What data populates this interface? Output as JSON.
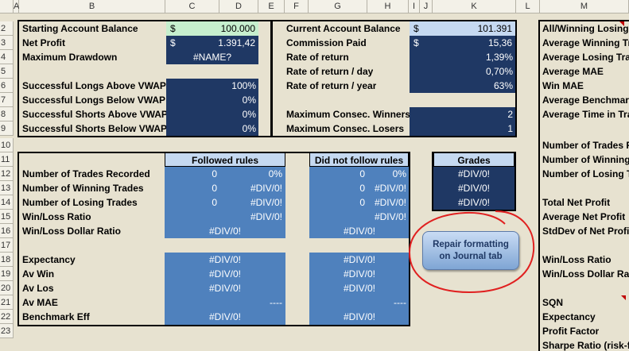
{
  "columns": [
    "A",
    "B",
    "C",
    "D",
    "E",
    "F",
    "G",
    "H",
    "I",
    "J",
    "K",
    "L",
    "M"
  ],
  "rows": [
    "2",
    "3",
    "4",
    "5",
    "6",
    "7",
    "8",
    "9",
    "10",
    "11",
    "12",
    "13",
    "14",
    "15",
    "16",
    "17",
    "18",
    "19",
    "20",
    "21",
    "22",
    "23"
  ],
  "summary": {
    "starting_balance": {
      "label": "Starting Account Balance",
      "currency": "$",
      "value": "100.000"
    },
    "net_profit": {
      "label": "Net Profit",
      "currency": "$",
      "value": "1.391,42"
    },
    "max_drawdown": {
      "label": "Maximum Drawdown",
      "value": "#NAME?"
    },
    "longs_above": {
      "label": "Successful Longs Above VWAP",
      "value": "100%"
    },
    "longs_below": {
      "label": "Successful Longs Below VWAP",
      "value": "0%"
    },
    "shorts_above": {
      "label": "Successful Shorts Above VWAP",
      "value": "0%"
    },
    "shorts_below": {
      "label": "Successful Shorts Below VWAP",
      "value": "0%"
    },
    "current_balance": {
      "label": "Current Account Balance",
      "currency": "$",
      "value": "101.391"
    },
    "commission": {
      "label": "Commission Paid",
      "currency": "$",
      "value": "15,36"
    },
    "ror": {
      "label": "Rate of return",
      "value": "1,39%"
    },
    "ror_day": {
      "label": "Rate of return / day",
      "value": "0,70%"
    },
    "ror_year": {
      "label": "Rate of return / year",
      "value": "63%"
    },
    "consec_winners": {
      "label": "Maximum Consec. Winners",
      "value": "2"
    },
    "consec_losers": {
      "label": "Maximum Consec. Losers",
      "value": "1"
    }
  },
  "rules": {
    "followed_header": "Followed rules",
    "not_followed_header": "Did not follow rules",
    "grades_header": "Grades",
    "labels": {
      "trades_recorded": "Number of Trades Recorded",
      "winning_trades": "Number of Winning Trades",
      "losing_trades": "Number of Losing Trades",
      "wl_ratio": "Win/Loss Ratio",
      "wl_dollar": "Win/Loss Dollar Ratio",
      "expectancy": "Expectancy",
      "av_win": "Av Win",
      "av_los": "Av Los",
      "av_mae": "Av MAE",
      "bench_eff": "Benchmark Eff"
    },
    "followed": {
      "trades_n": "0",
      "trades_pct": "0%",
      "win_n": "0",
      "win_pct": "#DIV/0!",
      "los_n": "0",
      "los_pct": "#DIV/0!",
      "wl_ratio": "#DIV/0!",
      "wl_dollar": "#DIV/0!",
      "expectancy": "#DIV/0!",
      "av_win": "#DIV/0!",
      "av_los": "#DIV/0!",
      "av_mae": "----",
      "bench_eff": "#DIV/0!"
    },
    "not_followed": {
      "trades_n": "0",
      "trades_pct": "0%",
      "win_n": "0",
      "win_pct": "#DIV/0!",
      "los_n": "0",
      "los_pct": "#DIV/0!",
      "wl_ratio": "#DIV/0!",
      "wl_dollar": "#DIV/0!",
      "expectancy": "#DIV/0!",
      "av_win": "#DIV/0!",
      "av_los": "#DIV/0!",
      "av_mae": "----",
      "bench_eff": "#DIV/0!"
    },
    "grades": [
      "#DIV/0!",
      "#DIV/0!",
      "#DIV/0!"
    ]
  },
  "repair_button": "Repair formatting on Journal tab",
  "right_labels": [
    "All/Winning Losing",
    "Average Winning Tra",
    "Average Losing Trad",
    "Average MAE",
    "Win MAE",
    "Average Benchmark",
    "Average Time in Tra",
    "",
    "Number of Trades R",
    "Number of Winning",
    "Number of Losing Tr",
    "",
    "Total Net Profit",
    "Average Net Profit",
    "StdDev of Net Profit",
    "",
    "Win/Loss Ratio",
    "Win/Loss Dollar Rati",
    "",
    "SQN",
    "Expectancy",
    "Profit Factor",
    "Sharpe Ratio (risk-fr"
  ],
  "colors": {
    "navy": "#1f3864",
    "blue": "#4f81bd",
    "header": "#c5d9f1",
    "green": "#c6efce",
    "annotation": "#e02020"
  }
}
